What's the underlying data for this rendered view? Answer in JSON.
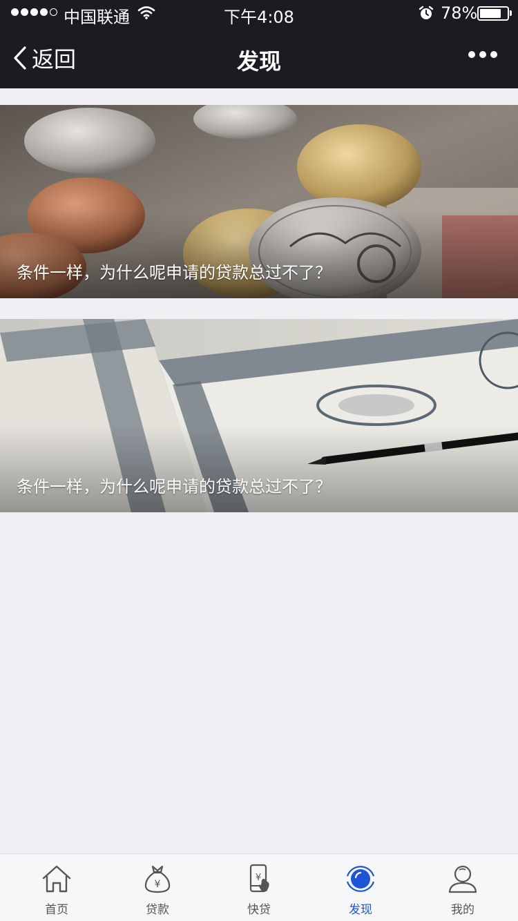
{
  "status_bar": {
    "carrier": "中国联通",
    "time": "下午4:08",
    "battery_percent": "78%",
    "battery_level": 0.78
  },
  "nav": {
    "back_label": "返回",
    "title": "发现"
  },
  "articles": [
    {
      "title": "条件一样，为什么呢申请的贷款总过不了？"
    },
    {
      "title": "条件一样，为什么呢申请的贷款总过不了？"
    }
  ],
  "tabbar": {
    "active_color": "#1d55d6",
    "items": [
      {
        "label": "首页",
        "icon": "home-icon"
      },
      {
        "label": "贷款",
        "icon": "money-bag-icon"
      },
      {
        "label": "快贷",
        "icon": "phone-yen-icon"
      },
      {
        "label": "发现",
        "icon": "discover-icon",
        "active": true
      },
      {
        "label": "我的",
        "icon": "profile-icon"
      }
    ]
  }
}
